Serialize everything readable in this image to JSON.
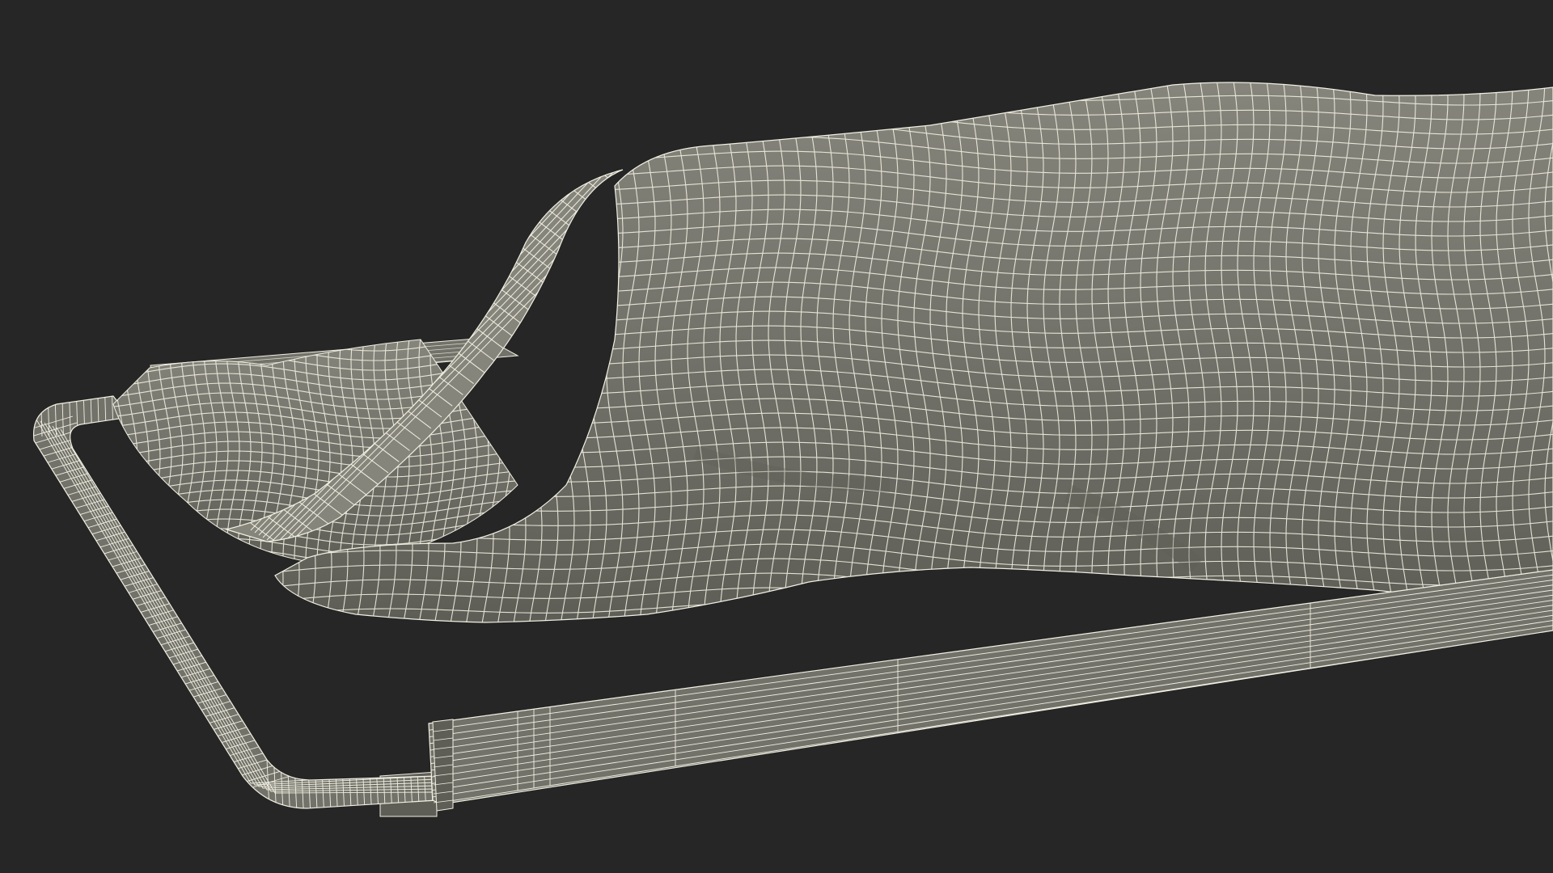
{
  "scene": {
    "background_color": "#262626",
    "mesh_fill_color": "#72726a",
    "mesh_shade_color": "#5e5e57",
    "mesh_light_color": "#86857c",
    "wire_color": "#f2f0e2",
    "subject": "wireframe-covered-body-on-stretcher"
  }
}
